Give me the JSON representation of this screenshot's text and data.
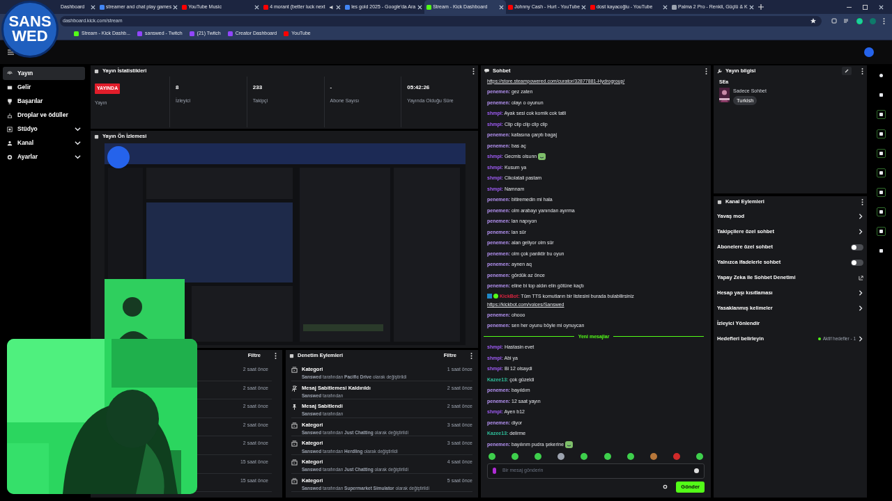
{
  "overlay_logo": [
    "SANS",
    "WED"
  ],
  "browser": {
    "tabs": [
      {
        "title": "Dashboard",
        "selected": false
      },
      {
        "title": "streamer and chat play games",
        "selected": false,
        "color": "#4285f4"
      },
      {
        "title": "YouTube Music",
        "selected": false,
        "color": "#ff0000"
      },
      {
        "title": "4 morant (better luck next",
        "selected": false,
        "color": "#ff0000",
        "audio": true
      },
      {
        "title": "les gold 2025 - Google'da Ara",
        "selected": false,
        "color": "#4285f4"
      },
      {
        "title": "Stream - Kick Dashboard",
        "selected": true,
        "color": "#53fc18"
      },
      {
        "title": "Johnny Cash - Hurt - YouTube",
        "selected": false,
        "color": "#ff0000"
      },
      {
        "title": "dost kayacoğlu - YouTube",
        "selected": false,
        "color": "#ff0000"
      },
      {
        "title": "Palma 2 Pro - Renkli, Güçlü & K",
        "selected": false,
        "color": "#9ca3af"
      }
    ],
    "address": "dashboard.kick.com/stream",
    "bookmarks": [
      {
        "title": "Stream - Kick Dashb...",
        "color": "#53fc18"
      },
      {
        "title": "sanswed - Twitch",
        "color": "#9146ff"
      },
      {
        "title": "(21) Twitch",
        "color": "#9146ff"
      },
      {
        "title": "Creator Dashboard",
        "color": "#9146ff"
      },
      {
        "title": "YouTube",
        "color": "#ff0000"
      }
    ]
  },
  "sidebar": {
    "items": [
      {
        "label": "Yayın",
        "selected": true,
        "expandable": false
      },
      {
        "label": "Gelir",
        "selected": false,
        "expandable": false
      },
      {
        "label": "Başarılar",
        "selected": false,
        "expandable": false
      },
      {
        "label": "Droplar ve ödüller",
        "selected": false,
        "expandable": false
      },
      {
        "label": "Stüdyo",
        "selected": false,
        "expandable": true
      },
      {
        "label": "Kanal",
        "selected": false,
        "expandable": true
      },
      {
        "label": "Ayarlar",
        "selected": false,
        "expandable": true
      }
    ]
  },
  "stats": {
    "title": "Yayın İstatistikleri",
    "status": "YAYINDA",
    "status_label": "Yayın",
    "items": [
      {
        "value": "8",
        "label": "İzleyici"
      },
      {
        "value": "233",
        "label": "Takipçi"
      },
      {
        "value": "-",
        "label": "Abone Sayısı"
      },
      {
        "value": "05:42:26",
        "label": "Yayında Olduğu Süre"
      }
    ]
  },
  "preview": {
    "title": "Yayın Ön İzlemesi"
  },
  "events_panel": {
    "filter": "Filtre",
    "times": [
      "2 saat önce",
      "2 saat önce",
      "2 saat önce",
      "2 saat önce",
      "2 saat önce",
      "15 saat önce",
      "15 saat önce"
    ]
  },
  "moderation": {
    "title": "Denetim Eylemleri",
    "filter": "Filtre",
    "items": [
      {
        "kind": "category",
        "title": "Kategori",
        "detail": "**Sanswed** tarafından **Pacific Drive** olarak değiştirildi",
        "time": "1 saat önce"
      },
      {
        "kind": "unpin",
        "title": "Mesaj Sabitlemesi Kaldırıldı",
        "detail": "**Sanswed** tarafından",
        "time": "2 saat önce"
      },
      {
        "kind": "pin",
        "title": "Mesaj Sabitlendi",
        "detail": "**Sanswed** tarafından",
        "time": "2 saat önce"
      },
      {
        "kind": "category",
        "title": "Kategori",
        "detail": "**Sanswed** tarafından **Just Chatting** olarak değiştirildi",
        "time": "3 saat önce"
      },
      {
        "kind": "category",
        "title": "Kategori",
        "detail": "**Sanswed** tarafından **Herdling** olarak değiştirildi",
        "time": "3 saat önce"
      },
      {
        "kind": "category",
        "title": "Kategori",
        "detail": "**Sanswed** tarafından **Just Chatting** olarak değiştirildi",
        "time": "4 saat önce"
      },
      {
        "kind": "category",
        "title": "Kategori",
        "detail": "**Sanswed** tarafından **Supermarket Simulator** olarak değiştirildi",
        "time": "5 saat önce"
      }
    ]
  },
  "chat": {
    "title": "Sohbet",
    "messages": [
      {
        "kind": "link",
        "text": "https://store.steampowered.com/curator/32877881-Hydrogroup/"
      },
      {
        "kind": "message",
        "user": "penemen:",
        "color": "#b794f6",
        "text": "gez zaten"
      },
      {
        "kind": "message",
        "user": "penemen:",
        "color": "#b794f6",
        "text": "olayı o oyunun"
      },
      {
        "kind": "message",
        "user": "shmpi:",
        "color": "#9f5cf5",
        "text": "Ayak sesi cok komik cok tatli"
      },
      {
        "kind": "message",
        "user": "shmpi:",
        "color": "#9f5cf5",
        "text": "Clip clip clip clip clip"
      },
      {
        "kind": "message",
        "user": "penemen:",
        "color": "#b794f6",
        "text": "kafasına çarptı bagaj"
      },
      {
        "kind": "message",
        "user": "penemen:",
        "color": "#b794f6",
        "text": "bas aç"
      },
      {
        "kind": "message",
        "user": "shmpi:",
        "color": "#9f5cf5",
        "text": "Gecmis olsunn",
        "emote": true
      },
      {
        "kind": "message",
        "user": "shmpi:",
        "color": "#9f5cf5",
        "text": "Kusum ya"
      },
      {
        "kind": "message",
        "user": "shmpi:",
        "color": "#9f5cf5",
        "text": "Cikolatali pastam"
      },
      {
        "kind": "message",
        "user": "shmpi:",
        "color": "#9f5cf5",
        "text": "Namnam"
      },
      {
        "kind": "message",
        "user": "penemen:",
        "color": "#b794f6",
        "text": "bitiremedin mi hala"
      },
      {
        "kind": "message",
        "user": "penemen:",
        "color": "#b794f6",
        "text": "olm arabayı yanından ayırma"
      },
      {
        "kind": "message",
        "user": "penemen:",
        "color": "#b794f6",
        "text": "lan napıyon"
      },
      {
        "kind": "message",
        "user": "penemen:",
        "color": "#b794f6",
        "text": "lan sür"
      },
      {
        "kind": "message",
        "user": "penemen:",
        "color": "#b794f6",
        "text": "alan geliyor olm sür"
      },
      {
        "kind": "message",
        "user": "penemen:",
        "color": "#b794f6",
        "text": "olm çok paniktir bu oyun"
      },
      {
        "kind": "message",
        "user": "penemen:",
        "color": "#b794f6",
        "text": "aynen aq"
      },
      {
        "kind": "message",
        "user": "penemen:",
        "color": "#b794f6",
        "text": "gördük az önce"
      },
      {
        "kind": "message",
        "user": "penemen:",
        "color": "#b794f6",
        "text": "eline bi top aldın elin götüne kaçtı"
      },
      {
        "kind": "bot",
        "user": "KickBot:",
        "color": "#d9243f",
        "text": "Tüm TTS komutların bir listesini burada bulabilirsiniz",
        "link": "https://kickbot.com/voices/Sanswed"
      },
      {
        "kind": "message",
        "user": "penemen:",
        "color": "#b794f6",
        "text": "ohooo"
      },
      {
        "kind": "message",
        "user": "penemen:",
        "color": "#b794f6",
        "text": "sen her oyunu böyle mi oynuycan"
      },
      {
        "kind": "divider",
        "text": "Yeni mesajlar"
      },
      {
        "kind": "message",
        "user": "shmpi:",
        "color": "#9f5cf5",
        "text": "Hastasin evet"
      },
      {
        "kind": "message",
        "user": "shmpi:",
        "color": "#9f5cf5",
        "text": "Abi ya"
      },
      {
        "kind": "message",
        "user": "shmpi:",
        "color": "#9f5cf5",
        "text": "Bi 12 olsaydi"
      },
      {
        "kind": "message",
        "user": "Kazee13:",
        "color": "#2fbf9b",
        "text": "çok güzeldi"
      },
      {
        "kind": "message",
        "user": "penemen:",
        "color": "#b794f6",
        "text": "bayıldım"
      },
      {
        "kind": "message",
        "user": "penemen:",
        "color": "#b794f6",
        "text": "12 saat yayın"
      },
      {
        "kind": "message",
        "user": "shmpi:",
        "color": "#9f5cf5",
        "text": "Ayen b12"
      },
      {
        "kind": "message",
        "user": "penemen:",
        "color": "#b794f6",
        "text": "diyor"
      },
      {
        "kind": "message",
        "user": "Kazee13:",
        "color": "#2fbf9b",
        "text": "delirme"
      },
      {
        "kind": "message",
        "user": "penemen:",
        "color": "#b794f6",
        "text": "bayılırım pudra şekerine",
        "emote": true
      }
    ],
    "placeholder": "Bir mesaj gönderin",
    "send": "Gönder"
  },
  "stream_info": {
    "title": "Yayın bilgisi",
    "stream_title": "SEa",
    "category": "Sadece Sohbet",
    "tag": "Turkish"
  },
  "channel_actions": {
    "title": "Kanal Eylemleri",
    "items": [
      {
        "kind": "chevron",
        "label": "Yavaş mod"
      },
      {
        "kind": "chevron",
        "label": "Takipçilere özel sohbet"
      },
      {
        "kind": "toggle",
        "label": "Abonelere özel sohbet",
        "on": false
      },
      {
        "kind": "toggle",
        "label": "Yalnızca ifadelerle sohbet",
        "on": false
      },
      {
        "kind": "external",
        "label": "Yapay Zeka ile Sohbet Denetimi"
      },
      {
        "kind": "chevron",
        "label": "Hesap yaşı kısıtlaması"
      },
      {
        "kind": "chevron",
        "label": "Yasaklanmış kelimeler"
      },
      {
        "kind": "plain",
        "label": "İzleyici Yönlendir"
      },
      {
        "kind": "goal",
        "label": "Hedefleri belirleyin",
        "status": "Aktif hedefler - 1"
      }
    ]
  }
}
